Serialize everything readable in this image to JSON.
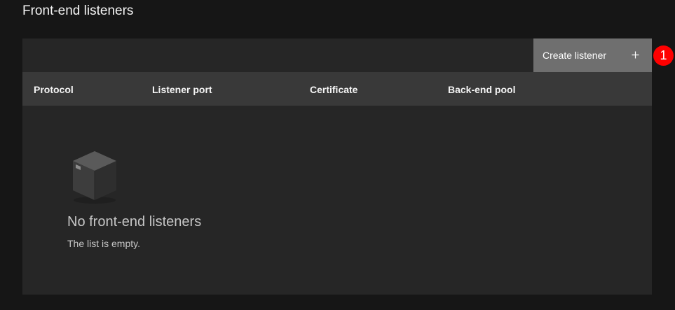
{
  "section": {
    "title": "Front-end listeners"
  },
  "toolbar": {
    "create_label": "Create listener",
    "create_icon": "plus-icon"
  },
  "badge": {
    "label": "1",
    "color": "#ff0000"
  },
  "table": {
    "headers": [
      "Protocol",
      "Listener port",
      "Certificate",
      "Back-end pool"
    ]
  },
  "empty_state": {
    "icon": "box-icon",
    "title": "No front-end listeners",
    "description": "The list is empty."
  }
}
